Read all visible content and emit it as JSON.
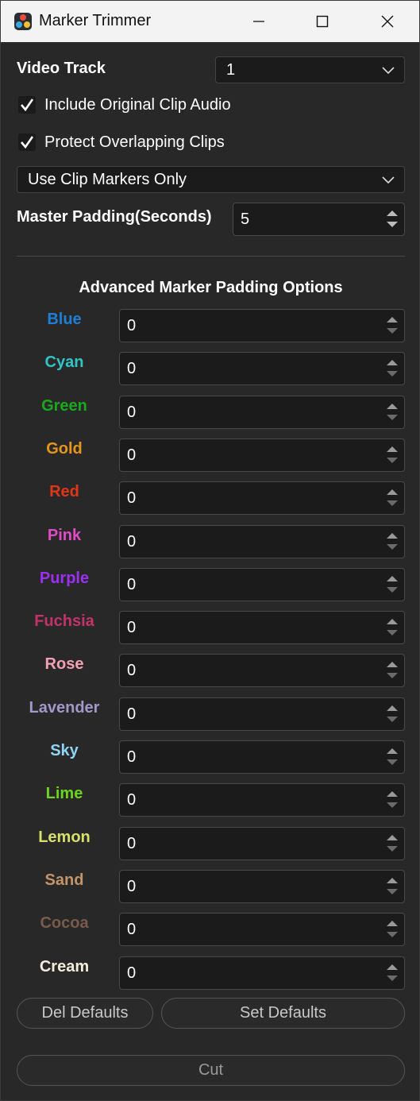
{
  "window": {
    "title": "Marker Trimmer"
  },
  "video_track": {
    "label": "Video Track",
    "value": "1"
  },
  "include_audio": {
    "label": "Include Original Clip Audio",
    "checked": true
  },
  "protect_overlap": {
    "label": "Protect Overlapping Clips",
    "checked": true
  },
  "marker_mode": {
    "value": "Use Clip Markers Only"
  },
  "master_padding": {
    "label": "Master Padding(Seconds)",
    "value": "5"
  },
  "advanced": {
    "title": "Advanced Marker Padding Options",
    "markers": [
      {
        "label": "Blue",
        "color": "#1f7fd6",
        "value": "0"
      },
      {
        "label": "Cyan",
        "color": "#2ec4c8",
        "value": "0"
      },
      {
        "label": "Green",
        "color": "#1ca81c",
        "value": "0"
      },
      {
        "label": "Gold",
        "color": "#e5961b",
        "value": "0"
      },
      {
        "label": "Red",
        "color": "#e03616",
        "value": "0"
      },
      {
        "label": "Pink",
        "color": "#e04bc6",
        "value": "0"
      },
      {
        "label": "Purple",
        "color": "#9b30f0",
        "value": "0"
      },
      {
        "label": "Fuchsia",
        "color": "#c2336a",
        "value": "0"
      },
      {
        "label": "Rose",
        "color": "#f2a0b4",
        "value": "0"
      },
      {
        "label": "Lavender",
        "color": "#a497c9",
        "value": "0"
      },
      {
        "label": "Sky",
        "color": "#8fd4f5",
        "value": "0"
      },
      {
        "label": "Lime",
        "color": "#6cd61c",
        "value": "0"
      },
      {
        "label": "Lemon",
        "color": "#d8e06a",
        "value": "0"
      },
      {
        "label": "Sand",
        "color": "#c29468",
        "value": "0"
      },
      {
        "label": "Cocoa",
        "color": "#7a5a4c",
        "value": "0"
      },
      {
        "label": "Cream",
        "color": "#f4ecdc",
        "value": "0"
      }
    ]
  },
  "buttons": {
    "del_defaults": "Del Defaults",
    "set_defaults": "Set Defaults",
    "cut": "Cut"
  }
}
